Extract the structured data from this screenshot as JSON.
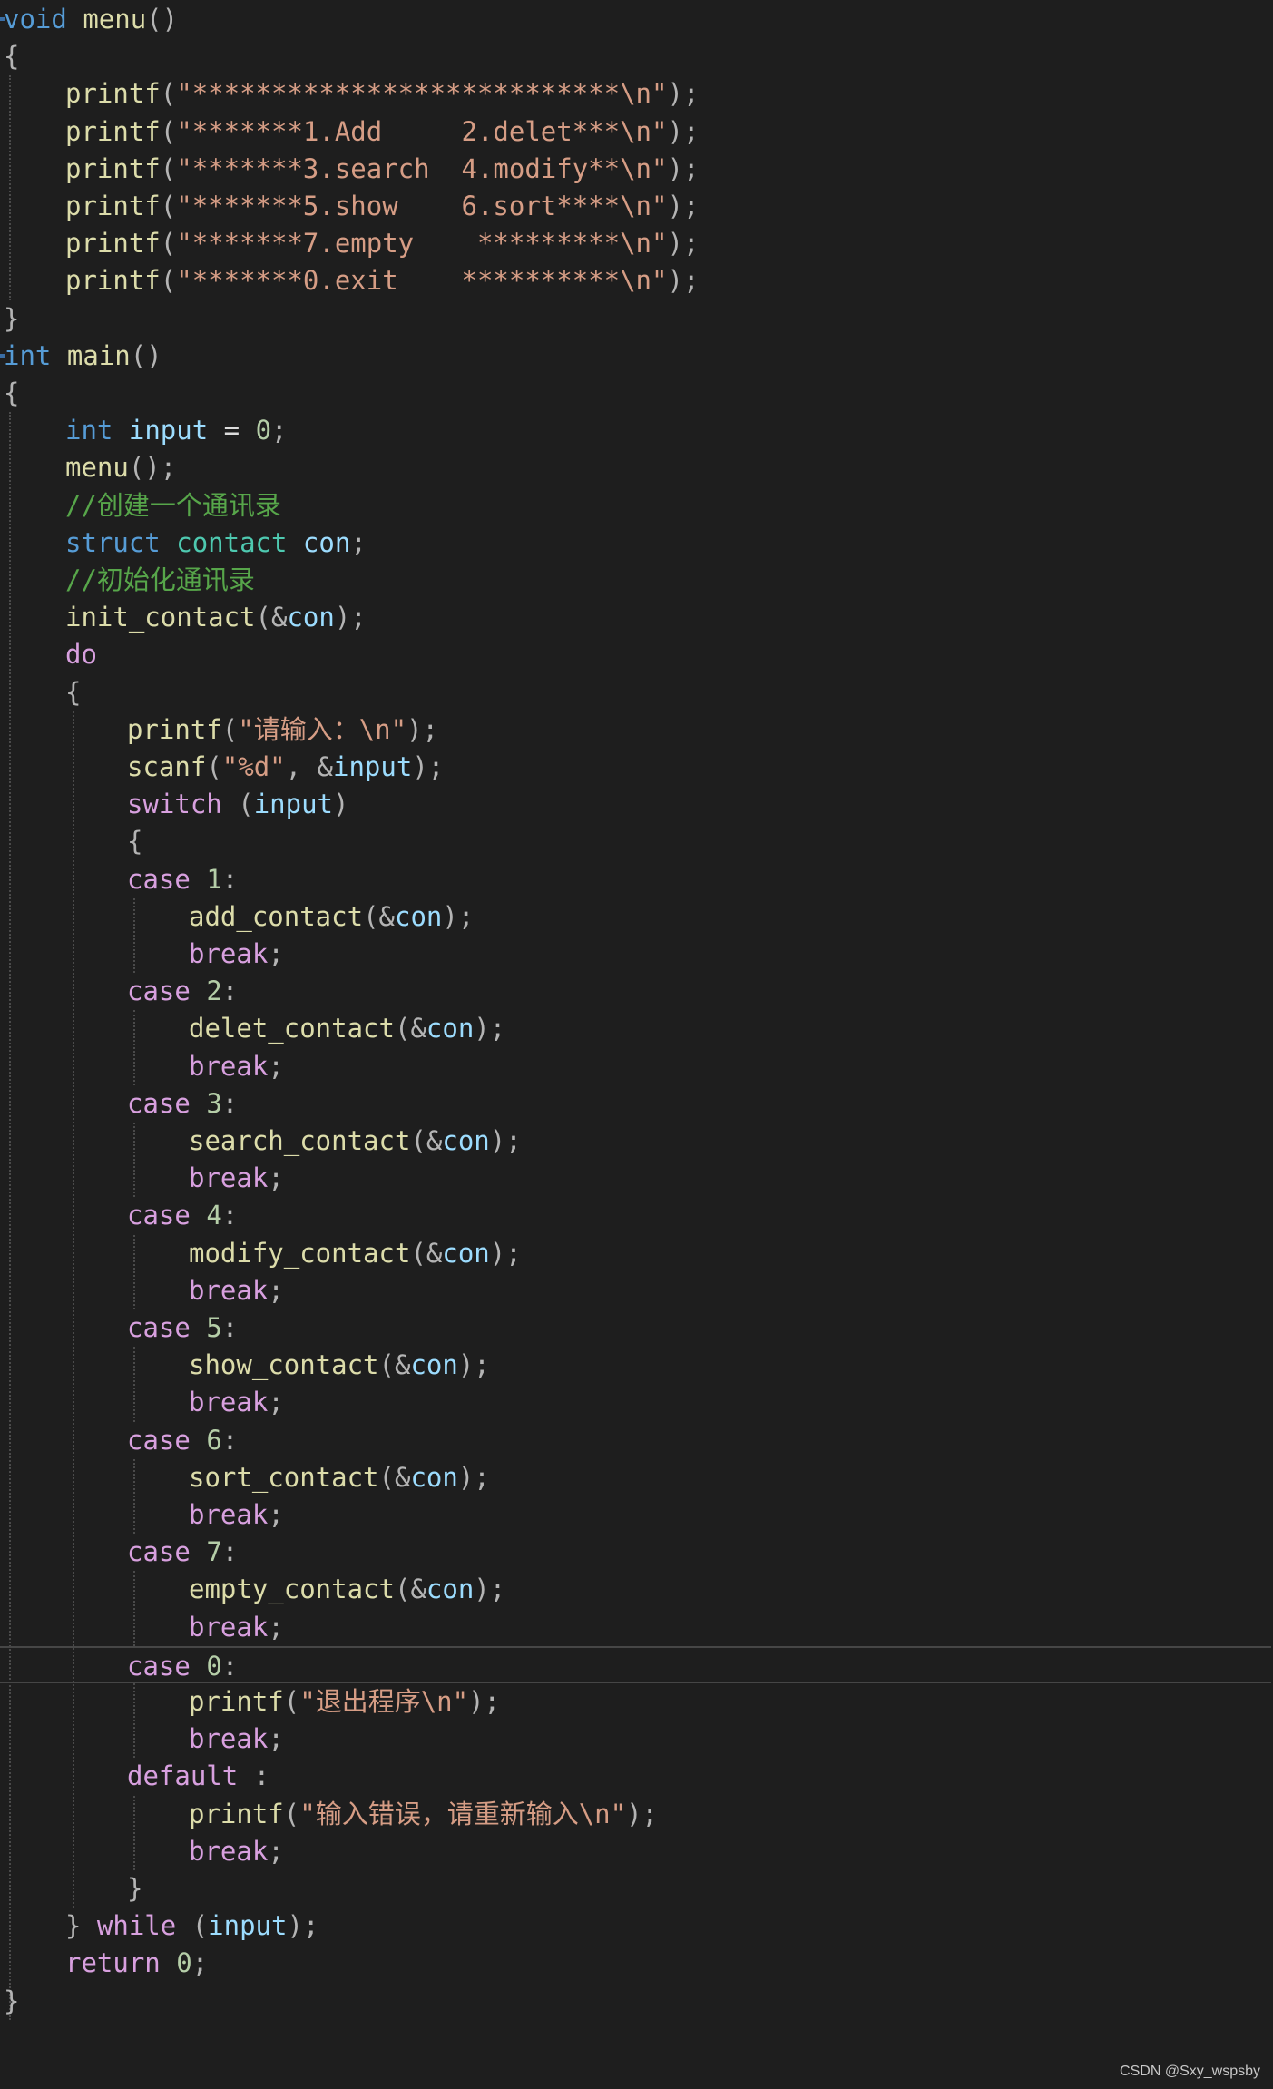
{
  "colors": {
    "background": "#1e1e1e",
    "kw": "#569cd6",
    "type": "#4ec9b0",
    "fn": "#dcdcaa",
    "str": "#d69d85",
    "num": "#b5cea8",
    "var": "#9cdcfe",
    "ctrl": "#d8a0df",
    "cmt": "#57a64a",
    "punc": "#b4b4b4",
    "plain": "#dcdcdc",
    "guide": "#4a4a4a"
  },
  "code_lines": [
    {
      "indent": 0,
      "tokens": [
        [
          "kw",
          "void"
        ],
        [
          "plain",
          " "
        ],
        [
          "fn",
          "menu"
        ],
        [
          "punc",
          "()"
        ]
      ]
    },
    {
      "indent": 0,
      "tokens": [
        [
          "punc",
          "{"
        ]
      ]
    },
    {
      "indent": 1,
      "tokens": [
        [
          "fn",
          "printf"
        ],
        [
          "punc",
          "("
        ],
        [
          "str",
          "\"***************************\\n\""
        ],
        [
          "punc",
          ");"
        ]
      ]
    },
    {
      "indent": 1,
      "tokens": [
        [
          "fn",
          "printf"
        ],
        [
          "punc",
          "("
        ],
        [
          "str",
          "\"*******1.Add     2.delet***\\n\""
        ],
        [
          "punc",
          ");"
        ]
      ]
    },
    {
      "indent": 1,
      "tokens": [
        [
          "fn",
          "printf"
        ],
        [
          "punc",
          "("
        ],
        [
          "str",
          "\"*******3.search  4.modify**\\n\""
        ],
        [
          "punc",
          ");"
        ]
      ]
    },
    {
      "indent": 1,
      "tokens": [
        [
          "fn",
          "printf"
        ],
        [
          "punc",
          "("
        ],
        [
          "str",
          "\"*******5.show    6.sort****\\n\""
        ],
        [
          "punc",
          ");"
        ]
      ]
    },
    {
      "indent": 1,
      "tokens": [
        [
          "fn",
          "printf"
        ],
        [
          "punc",
          "("
        ],
        [
          "str",
          "\"*******7.empty    *********\\n\""
        ],
        [
          "punc",
          ");"
        ]
      ]
    },
    {
      "indent": 1,
      "tokens": [
        [
          "fn",
          "printf"
        ],
        [
          "punc",
          "("
        ],
        [
          "str",
          "\"*******0.exit    **********\\n\""
        ],
        [
          "punc",
          ");"
        ]
      ]
    },
    {
      "indent": 0,
      "tokens": [
        [
          "punc",
          "}"
        ]
      ]
    },
    {
      "indent": 0,
      "tokens": [
        [
          "kw",
          "int"
        ],
        [
          "plain",
          " "
        ],
        [
          "fn",
          "main"
        ],
        [
          "punc",
          "()"
        ]
      ]
    },
    {
      "indent": 0,
      "tokens": [
        [
          "punc",
          "{"
        ]
      ]
    },
    {
      "indent": 1,
      "tokens": [
        [
          "kw",
          "int"
        ],
        [
          "plain",
          " "
        ],
        [
          "var",
          "input"
        ],
        [
          "plain",
          " = "
        ],
        [
          "num",
          "0"
        ],
        [
          "punc",
          ";"
        ]
      ]
    },
    {
      "indent": 1,
      "tokens": [
        [
          "fn",
          "menu"
        ],
        [
          "punc",
          "();"
        ]
      ]
    },
    {
      "indent": 1,
      "tokens": [
        [
          "cmt",
          "//创建一个通讯录"
        ]
      ]
    },
    {
      "indent": 1,
      "tokens": [
        [
          "kw",
          "struct"
        ],
        [
          "plain",
          " "
        ],
        [
          "type",
          "contact"
        ],
        [
          "plain",
          " "
        ],
        [
          "var",
          "con"
        ],
        [
          "punc",
          ";"
        ]
      ]
    },
    {
      "indent": 1,
      "tokens": [
        [
          "cmt",
          "//初始化通讯录"
        ]
      ]
    },
    {
      "indent": 1,
      "tokens": [
        [
          "fn",
          "init_contact"
        ],
        [
          "punc",
          "(&"
        ],
        [
          "var",
          "con"
        ],
        [
          "punc",
          ");"
        ]
      ]
    },
    {
      "indent": 1,
      "tokens": [
        [
          "ctrl",
          "do"
        ]
      ]
    },
    {
      "indent": 1,
      "tokens": [
        [
          "punc",
          "{"
        ]
      ]
    },
    {
      "indent": 2,
      "tokens": [
        [
          "fn",
          "printf"
        ],
        [
          "punc",
          "("
        ],
        [
          "str",
          "\"请输入：\\n\""
        ],
        [
          "punc",
          ");"
        ]
      ]
    },
    {
      "indent": 2,
      "tokens": [
        [
          "fn",
          "scanf"
        ],
        [
          "punc",
          "("
        ],
        [
          "str",
          "\"%d\""
        ],
        [
          "punc",
          ", &"
        ],
        [
          "var",
          "input"
        ],
        [
          "punc",
          ");"
        ]
      ]
    },
    {
      "indent": 2,
      "tokens": [
        [
          "ctrl",
          "switch"
        ],
        [
          "plain",
          " "
        ],
        [
          "punc",
          "("
        ],
        [
          "var",
          "input"
        ],
        [
          "punc",
          ")"
        ]
      ]
    },
    {
      "indent": 2,
      "tokens": [
        [
          "punc",
          "{"
        ]
      ]
    },
    {
      "indent": 2,
      "tokens": [
        [
          "ctrl",
          "case"
        ],
        [
          "plain",
          " "
        ],
        [
          "num",
          "1"
        ],
        [
          "punc",
          ":"
        ]
      ]
    },
    {
      "indent": 3,
      "tokens": [
        [
          "fn",
          "add_contact"
        ],
        [
          "punc",
          "(&"
        ],
        [
          "var",
          "con"
        ],
        [
          "punc",
          ");"
        ]
      ]
    },
    {
      "indent": 3,
      "tokens": [
        [
          "ctrl",
          "break"
        ],
        [
          "punc",
          ";"
        ]
      ]
    },
    {
      "indent": 2,
      "tokens": [
        [
          "ctrl",
          "case"
        ],
        [
          "plain",
          " "
        ],
        [
          "num",
          "2"
        ],
        [
          "punc",
          ":"
        ]
      ]
    },
    {
      "indent": 3,
      "tokens": [
        [
          "fn",
          "delet_contact"
        ],
        [
          "punc",
          "(&"
        ],
        [
          "var",
          "con"
        ],
        [
          "punc",
          ");"
        ]
      ]
    },
    {
      "indent": 3,
      "tokens": [
        [
          "ctrl",
          "break"
        ],
        [
          "punc",
          ";"
        ]
      ]
    },
    {
      "indent": 2,
      "tokens": [
        [
          "ctrl",
          "case"
        ],
        [
          "plain",
          " "
        ],
        [
          "num",
          "3"
        ],
        [
          "punc",
          ":"
        ]
      ]
    },
    {
      "indent": 3,
      "tokens": [
        [
          "fn",
          "search_contact"
        ],
        [
          "punc",
          "(&"
        ],
        [
          "var",
          "con"
        ],
        [
          "punc",
          ");"
        ]
      ]
    },
    {
      "indent": 3,
      "tokens": [
        [
          "ctrl",
          "break"
        ],
        [
          "punc",
          ";"
        ]
      ]
    },
    {
      "indent": 2,
      "tokens": [
        [
          "ctrl",
          "case"
        ],
        [
          "plain",
          " "
        ],
        [
          "num",
          "4"
        ],
        [
          "punc",
          ":"
        ]
      ]
    },
    {
      "indent": 3,
      "tokens": [
        [
          "fn",
          "modify_contact"
        ],
        [
          "punc",
          "(&"
        ],
        [
          "var",
          "con"
        ],
        [
          "punc",
          ");"
        ]
      ]
    },
    {
      "indent": 3,
      "tokens": [
        [
          "ctrl",
          "break"
        ],
        [
          "punc",
          ";"
        ]
      ]
    },
    {
      "indent": 2,
      "tokens": [
        [
          "ctrl",
          "case"
        ],
        [
          "plain",
          " "
        ],
        [
          "num",
          "5"
        ],
        [
          "punc",
          ":"
        ]
      ]
    },
    {
      "indent": 3,
      "tokens": [
        [
          "fn",
          "show_contact"
        ],
        [
          "punc",
          "(&"
        ],
        [
          "var",
          "con"
        ],
        [
          "punc",
          ");"
        ]
      ]
    },
    {
      "indent": 3,
      "tokens": [
        [
          "ctrl",
          "break"
        ],
        [
          "punc",
          ";"
        ]
      ]
    },
    {
      "indent": 2,
      "tokens": [
        [
          "ctrl",
          "case"
        ],
        [
          "plain",
          " "
        ],
        [
          "num",
          "6"
        ],
        [
          "punc",
          ":"
        ]
      ]
    },
    {
      "indent": 3,
      "tokens": [
        [
          "fn",
          "sort_contact"
        ],
        [
          "punc",
          "(&"
        ],
        [
          "var",
          "con"
        ],
        [
          "punc",
          ");"
        ]
      ]
    },
    {
      "indent": 3,
      "tokens": [
        [
          "ctrl",
          "break"
        ],
        [
          "punc",
          ";"
        ]
      ]
    },
    {
      "indent": 2,
      "tokens": [
        [
          "ctrl",
          "case"
        ],
        [
          "plain",
          " "
        ],
        [
          "num",
          "7"
        ],
        [
          "punc",
          ":"
        ]
      ]
    },
    {
      "indent": 3,
      "tokens": [
        [
          "fn",
          "empty_contact"
        ],
        [
          "punc",
          "(&"
        ],
        [
          "var",
          "con"
        ],
        [
          "punc",
          ");"
        ]
      ]
    },
    {
      "indent": 3,
      "tokens": [
        [
          "ctrl",
          "break"
        ],
        [
          "punc",
          ";"
        ]
      ]
    },
    {
      "indent": 2,
      "current": true,
      "tokens": [
        [
          "ctrl",
          "case"
        ],
        [
          "plain",
          " "
        ],
        [
          "num",
          "0"
        ],
        [
          "punc",
          ":"
        ]
      ]
    },
    {
      "indent": 3,
      "tokens": [
        [
          "fn",
          "printf"
        ],
        [
          "punc",
          "("
        ],
        [
          "str",
          "\"退出程序\\n\""
        ],
        [
          "punc",
          ");"
        ]
      ]
    },
    {
      "indent": 3,
      "tokens": [
        [
          "ctrl",
          "break"
        ],
        [
          "punc",
          ";"
        ]
      ]
    },
    {
      "indent": 2,
      "tokens": [
        [
          "ctrl",
          "default"
        ],
        [
          "plain",
          " "
        ],
        [
          "punc",
          ":"
        ]
      ]
    },
    {
      "indent": 3,
      "tokens": [
        [
          "fn",
          "printf"
        ],
        [
          "punc",
          "("
        ],
        [
          "str",
          "\"输入错误，请重新输入\\n\""
        ],
        [
          "punc",
          ");"
        ]
      ]
    },
    {
      "indent": 3,
      "tokens": [
        [
          "ctrl",
          "break"
        ],
        [
          "punc",
          ";"
        ]
      ]
    },
    {
      "indent": 2,
      "tokens": [
        [
          "punc",
          "}"
        ]
      ]
    },
    {
      "indent": 1,
      "tokens": [
        [
          "punc",
          "} "
        ],
        [
          "ctrl",
          "while"
        ],
        [
          "plain",
          " "
        ],
        [
          "punc",
          "("
        ],
        [
          "var",
          "input"
        ],
        [
          "punc",
          ");"
        ]
      ]
    },
    {
      "indent": 1,
      "tokens": [
        [
          "ctrl",
          "return"
        ],
        [
          "plain",
          " "
        ],
        [
          "num",
          "0"
        ],
        [
          "punc",
          ";"
        ]
      ]
    },
    {
      "indent": 0,
      "tokens": [
        [
          "punc",
          "}"
        ]
      ]
    }
  ],
  "watermark": "CSDN @Sxy_wspsby"
}
